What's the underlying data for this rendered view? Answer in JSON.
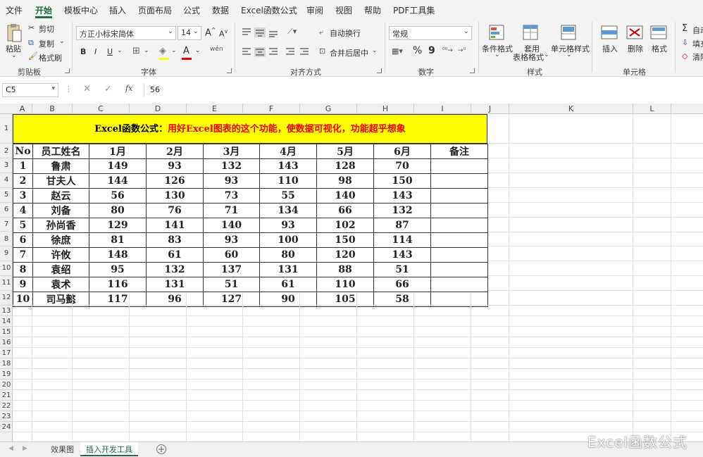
{
  "menu": {
    "tabs": [
      {
        "label": "文件",
        "active": false
      },
      {
        "label": "开始",
        "active": true
      },
      {
        "label": "模板中心",
        "active": false
      },
      {
        "label": "插入",
        "active": false
      },
      {
        "label": "页面布局",
        "active": false
      },
      {
        "label": "公式",
        "active": false
      },
      {
        "label": "数据",
        "active": false
      },
      {
        "label": "Excel函数公式",
        "active": false
      },
      {
        "label": "审阅",
        "active": false
      },
      {
        "label": "视图",
        "active": false
      },
      {
        "label": "帮助",
        "active": false
      },
      {
        "label": "PDF工具集",
        "active": false
      }
    ]
  },
  "ribbon": {
    "clipboard": {
      "label": "剪贴板",
      "paste": "粘贴",
      "cut": "剪切",
      "copy": "复制",
      "format_painter": "格式刷"
    },
    "font": {
      "label": "字体",
      "font_name": "方正小标宋简体",
      "font_size": "14"
    },
    "alignment": {
      "label": "对齐方式",
      "wrap": "自动换行",
      "merge": "合并后居中"
    },
    "number": {
      "label": "数字",
      "format": "常规"
    },
    "styles": {
      "label": "样式",
      "conditional": "条件格式",
      "table_line1": "套用",
      "table_line2": "表格格式",
      "cell_styles": "单元格样式"
    },
    "cells": {
      "label": "单元格",
      "insert": "插入",
      "delete": "删除",
      "format": "格式"
    },
    "editing": {
      "autosum": "自动",
      "fill": "填充",
      "clear": "清除"
    }
  },
  "formula_bar": {
    "name_box": "C5",
    "value": "56",
    "fx": "fx"
  },
  "columns": [
    "A",
    "B",
    "C",
    "D",
    "E",
    "F",
    "G",
    "H",
    "I",
    "J",
    "K",
    "L"
  ],
  "rows": [
    "1",
    "2",
    "3",
    "4",
    "5",
    "6",
    "7",
    "8",
    "9",
    "10",
    "11",
    "12",
    "13",
    "14",
    "15",
    "16",
    "17",
    "18",
    "19",
    "20",
    "21",
    "22",
    "23",
    "24"
  ],
  "sheet": {
    "title_black": "Excel函数公式：",
    "title_red": "用好Excel图表的这个功能，使数据可视化，功能超乎想象",
    "headers": [
      "No",
      "员工姓名",
      "1月",
      "2月",
      "3月",
      "4月",
      "5月",
      "6月",
      "备注"
    ],
    "data": [
      [
        "1",
        "鲁肃",
        "149",
        "93",
        "132",
        "143",
        "128",
        "70",
        ""
      ],
      [
        "2",
        "甘夫人",
        "144",
        "126",
        "93",
        "110",
        "98",
        "150",
        ""
      ],
      [
        "3",
        "赵云",
        "56",
        "130",
        "73",
        "55",
        "140",
        "143",
        ""
      ],
      [
        "4",
        "刘备",
        "80",
        "76",
        "71",
        "134",
        "66",
        "132",
        ""
      ],
      [
        "5",
        "孙尚香",
        "129",
        "141",
        "140",
        "93",
        "102",
        "87",
        ""
      ],
      [
        "6",
        "徐庶",
        "81",
        "83",
        "93",
        "100",
        "150",
        "114",
        ""
      ],
      [
        "7",
        "许攸",
        "148",
        "61",
        "60",
        "80",
        "120",
        "143",
        ""
      ],
      [
        "8",
        "袁绍",
        "95",
        "132",
        "137",
        "131",
        "88",
        "51",
        ""
      ],
      [
        "9",
        "袁术",
        "116",
        "131",
        "51",
        "61",
        "110",
        "66",
        ""
      ],
      [
        "10",
        "司马懿",
        "117",
        "96",
        "127",
        "90",
        "105",
        "58",
        ""
      ]
    ]
  },
  "sheet_tabs": [
    {
      "label": "效果图",
      "active": false
    },
    {
      "label": "插入开发工具",
      "active": true
    }
  ],
  "watermark": "Excel函数公式",
  "colors": {
    "accent": "#1e7145",
    "title_fill": "#ffff00",
    "title_red": "#ee0000"
  }
}
